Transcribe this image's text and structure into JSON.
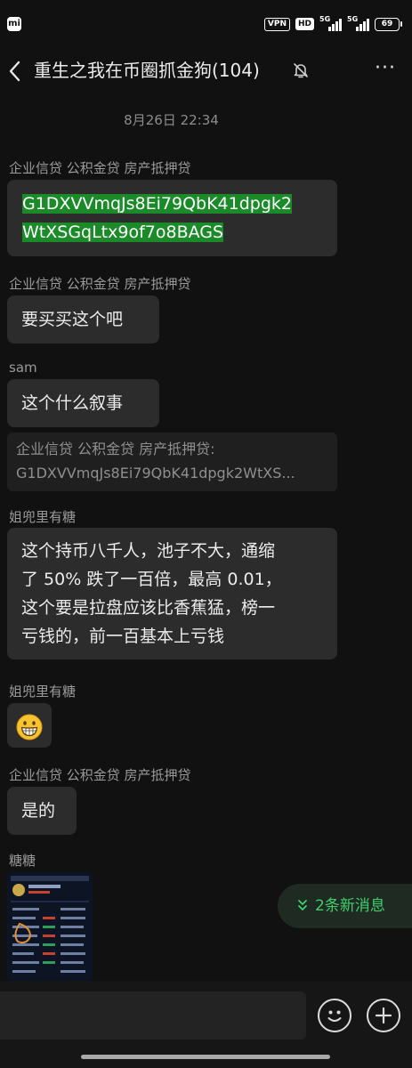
{
  "status_bar": {
    "brand": "mi",
    "vpn": "VPN",
    "hd": "HD",
    "network1": "5G",
    "network2": "5G",
    "battery": "69"
  },
  "header": {
    "back_icon": "chevron-left-icon",
    "title": "重生之我在币圈抓金狗(104)",
    "mute_icon": "bell-off-icon",
    "more": "···"
  },
  "timestamp": "8月26日 22:34",
  "messages": [
    {
      "sender": "企业信贷 公积金贷 房产抵押贷",
      "lines": [
        "G1DXVVmqJs8Ei79QbK41dpgk2",
        "WtXSGqLtx9of7o8BAGS"
      ]
    },
    {
      "sender": "企业信贷 公积金贷 房产抵押贷",
      "lines": [
        "要买买这个吧"
      ]
    },
    {
      "sender": "sam",
      "lines": [
        "这个什么叙事"
      ],
      "quote": [
        "企业信贷 公积金贷 房产抵押贷:",
        "G1DXVVmqJs8Ei79QbK41dpgk2WtXS..."
      ]
    },
    {
      "sender": "姐兜里有糖",
      "lines": [
        "这个持币八千人，池子不大，通缩",
        "了 50% 跌了一百倍，最高 0.01，",
        "这个要是拉盘应该比香蕉猛，榜一",
        "亏钱的，前一百基本上亏钱"
      ]
    },
    {
      "sender": "姐兜里有糖",
      "emoji": "grinning-emoji"
    },
    {
      "sender": "企业信贷 公积金贷 房产抵押贷",
      "lines": [
        "是的"
      ]
    },
    {
      "sender": "糖糖",
      "image": "trading-app-screenshot-thumbnail"
    }
  ],
  "new_messages": {
    "icon": "double-chevron-down-icon",
    "label": "2条新消息"
  },
  "input_bar": {
    "emoji_icon": "smiley-icon",
    "plus_icon": "plus-circle-icon"
  }
}
